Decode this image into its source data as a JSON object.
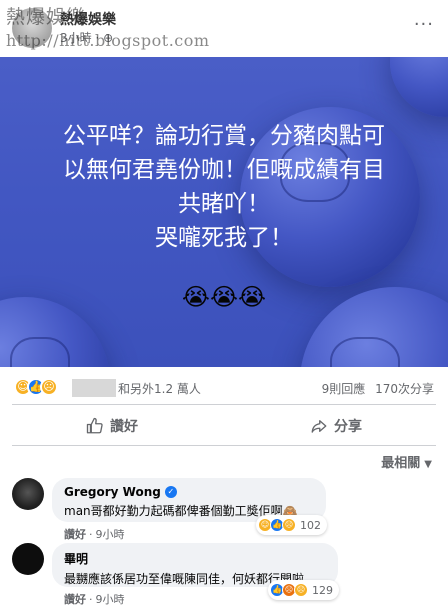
{
  "header": {
    "page_name": "熱爆娛樂",
    "post_meta": "3小時 · ⊕",
    "more_icon": "···"
  },
  "watermark": {
    "title": "熱爆娛樂",
    "url": "http://hitt.blogspot.com"
  },
  "post": {
    "lines": [
      "公平咩？論功行賞，分豬肉點可",
      "以無何君堯份咖！佢嘅成績有目",
      "共睹吖！",
      "哭嚨死我了！"
    ],
    "emojis": "😭😭😭"
  },
  "summary": {
    "reaction_icons": [
      "haha-icon",
      "like-icon",
      "sad-icon"
    ],
    "reactors": "和另外1.2 萬人",
    "comments_count": "9則回應",
    "shares_count": "170次分享"
  },
  "actions": {
    "like_label": "讚好",
    "share_label": "分享"
  },
  "sort": {
    "label": "最相關"
  },
  "comments": [
    {
      "author": "Gregory Wong",
      "verified": true,
      "text": "man哥都好勤力起碼都俾番個勤工獎佢啊🙈",
      "reaction_count": "102",
      "like_label": "讚好",
      "time": "9小時"
    },
    {
      "author": "畢明",
      "verified": false,
      "text": "最嬲應該係居功至偉嘅陳同佳，何妖都行開啦",
      "reaction_count": "129",
      "like_label": "讚好",
      "time": "9小時"
    }
  ],
  "colors": {
    "image_blue": "#4257c2",
    "fb_blue": "#1877f2",
    "secondary_text": "#65676b"
  }
}
